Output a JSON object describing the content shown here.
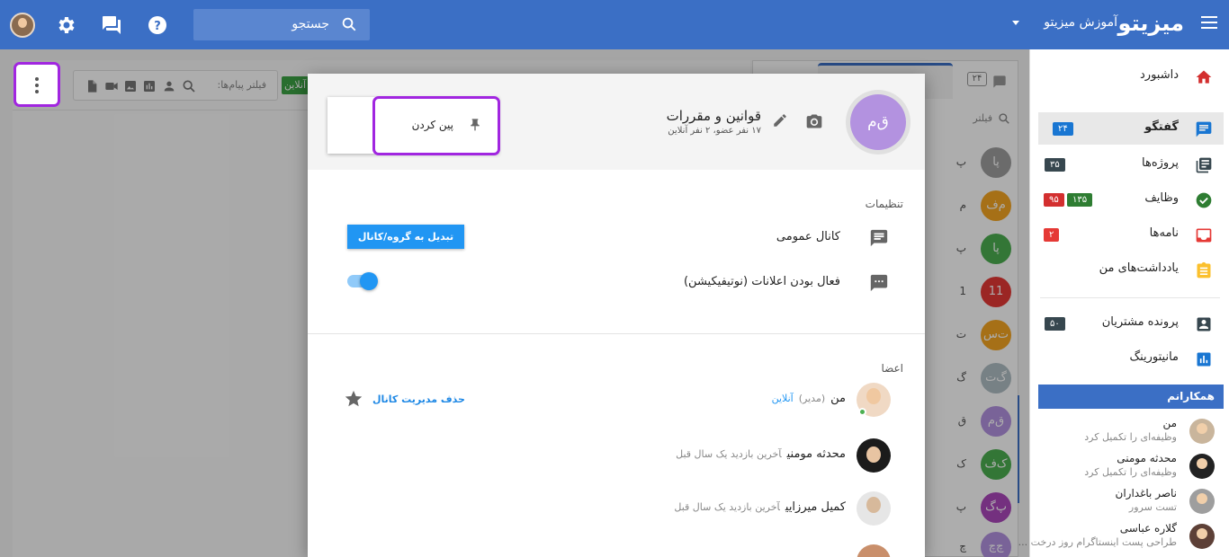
{
  "topbar": {
    "brand": "میزیتو",
    "org_name": "آموزش میزیتو",
    "search_placeholder": "جستجو"
  },
  "sidebar": {
    "items": [
      {
        "label": "داشبورد",
        "icon": "home-icon",
        "color": "#d32f2f"
      },
      {
        "label": "گفتگو",
        "icon": "chat-icon",
        "badge": "۲۴",
        "badge_color": "#1976d2",
        "active": true
      },
      {
        "label": "پروژه‌ها",
        "icon": "projects-icon",
        "badge": "۳۵",
        "badge_color": "#37474f"
      },
      {
        "label": "وظایف",
        "icon": "tasks-icon",
        "badges": [
          "۱۳۵",
          "۹۵"
        ],
        "badge_colors": [
          "#2e7d32",
          "#d32f2f"
        ]
      },
      {
        "label": "نامه‌ها",
        "icon": "letters-icon",
        "badge": "۲",
        "badge_color": "#e53935"
      },
      {
        "label": "یادداشت‌های من",
        "icon": "notes-icon"
      },
      {
        "label": "پرونده مشتریان",
        "icon": "customers-icon",
        "badge": "۵۰",
        "badge_color": "#37474f"
      },
      {
        "label": "مانیتورینگ",
        "icon": "monitoring-icon"
      }
    ],
    "colleagues_title": "همکارانم",
    "colleagues": [
      {
        "name": "من",
        "status": "وظیفه‌ای را تکمیل کرد"
      },
      {
        "name": "محدثه مومنی",
        "status": "وظیفه‌ای را تکمیل کرد"
      },
      {
        "name": "ناصر باغداران",
        "status": "تست سرور"
      },
      {
        "name": "گلاره عباسی",
        "status": "طراحی پست اینستاگرام روز درخت ..."
      }
    ]
  },
  "chat_list": {
    "count_badge": "۲۴",
    "filter_placeholder": "فیلتر",
    "rows": [
      {
        "initials": "پا",
        "color": "#9e9e9e",
        "snippet": "پ"
      },
      {
        "initials": "م‌ف",
        "color": "#f5a623",
        "snippet": "م"
      },
      {
        "initials": "پا",
        "color": "#4caf50",
        "snippet": "پ"
      },
      {
        "initials": "11",
        "color": "#e53935",
        "snippet": "1"
      },
      {
        "initials": "ت‌س",
        "color": "#f5a623",
        "snippet": "ت"
      },
      {
        "initials": "گ‌ت",
        "color": "#b0bec5",
        "snippet": "گ"
      },
      {
        "initials": "ق‌م",
        "color": "#b392e0",
        "snippet": "ق"
      },
      {
        "initials": "ک‌ف",
        "color": "#4caf50",
        "snippet": "ک"
      },
      {
        "initials": "پ‌گ",
        "color": "#ab47bc",
        "snippet": "پ"
      },
      {
        "initials": "چ‌چ",
        "color": "#b392e0",
        "snippet": "چ"
      }
    ]
  },
  "chat_panel": {
    "filter_placeholder": "فیلتر پیام‌ها:",
    "online_tag": "آنلاین"
  },
  "modal": {
    "avatar_initials": "ق‌م",
    "avatar_color": "#b392e0",
    "title": "قوانین و مقررات",
    "subtitle": "۱۷ نفر عضو، ۲ نفر آنلاین",
    "pin_label": "پین کردن",
    "settings_title": "تنظیمات",
    "public_channel_label": "کانال عمومی",
    "convert_button": "تبدیل به گروه/کانال عادی",
    "notifications_label": "فعال بودن اعلانات (نوتیفیکیشن)",
    "notifications_enabled": true,
    "members_title": "اعضا",
    "members": [
      {
        "name": "من",
        "role": "(مدیر)",
        "status": "آنلاین",
        "action": "حذف مدیریت کانال"
      },
      {
        "name": "محدثه مومنی",
        "last_seen": "آخرین بازدید یک سال قبل"
      },
      {
        "name": "کمیل میرزایی",
        "last_seen": "آخرین بازدید یک سال قبل"
      }
    ]
  }
}
